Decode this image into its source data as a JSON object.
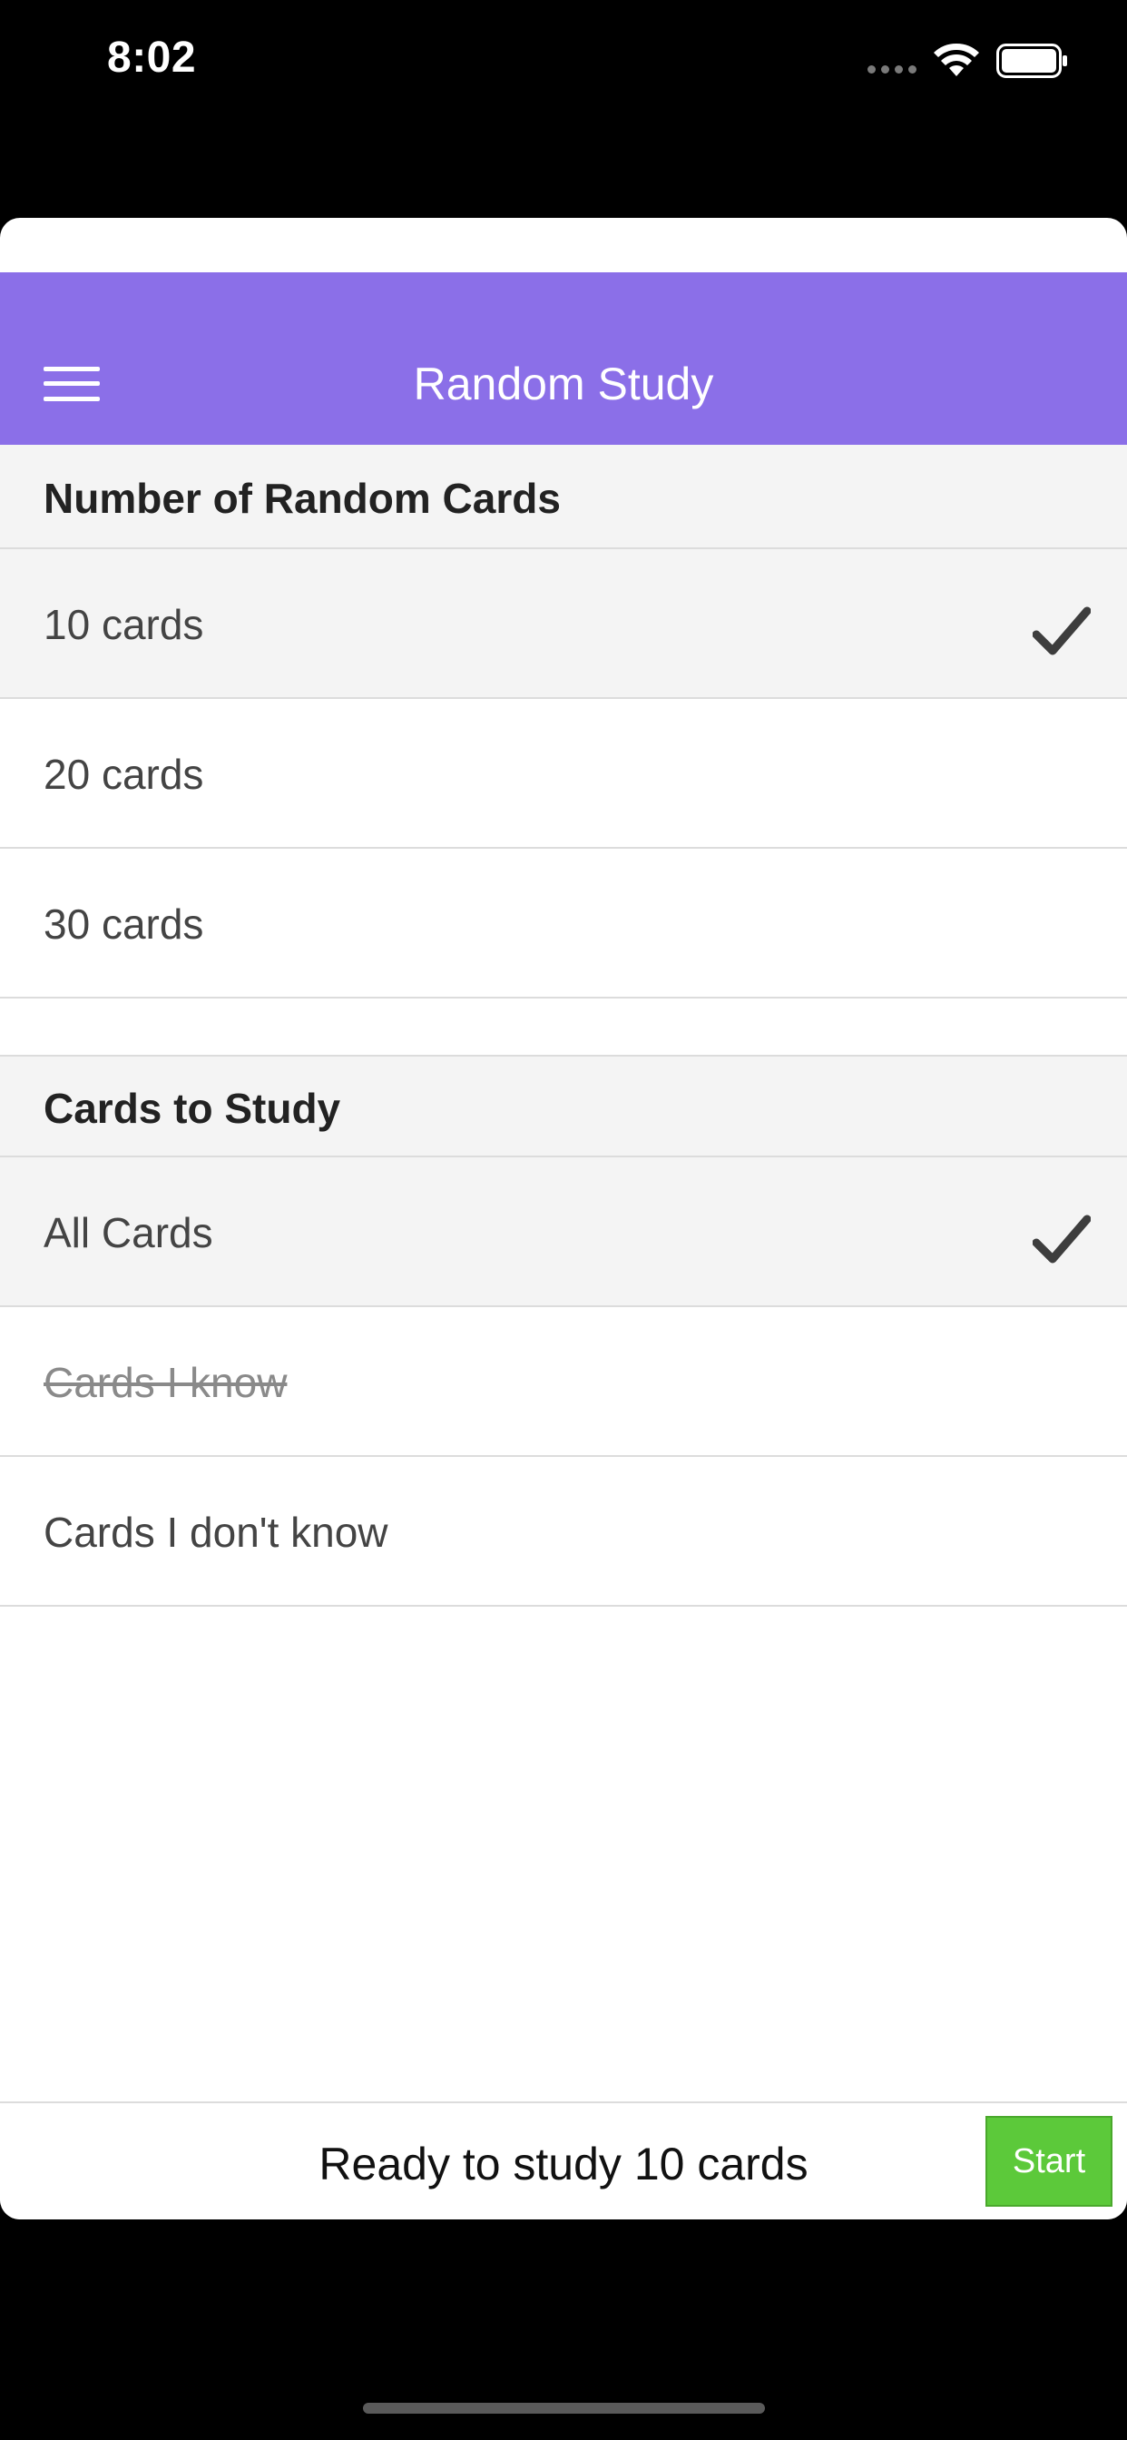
{
  "status_bar": {
    "time": "8:02"
  },
  "nav": {
    "title": "Random Study",
    "menu_icon": "hamburger-menu-icon",
    "background_color": "#8b6fe8"
  },
  "sections": [
    {
      "header": "Number of Random Cards",
      "rows": [
        {
          "label": "10 cards",
          "selected": true,
          "disabled": false
        },
        {
          "label": "20 cards",
          "selected": false,
          "disabled": false
        },
        {
          "label": "30 cards",
          "selected": false,
          "disabled": false
        }
      ]
    },
    {
      "header": "Cards to Study",
      "rows": [
        {
          "label": "All Cards",
          "selected": true,
          "disabled": false
        },
        {
          "label": "Cards I know",
          "selected": false,
          "disabled": true
        },
        {
          "label": "Cards I don't know",
          "selected": false,
          "disabled": false
        }
      ]
    }
  ],
  "footer": {
    "status_text": "Ready to study 10 cards",
    "start_label": "Start",
    "start_color": "#5cc93a"
  }
}
